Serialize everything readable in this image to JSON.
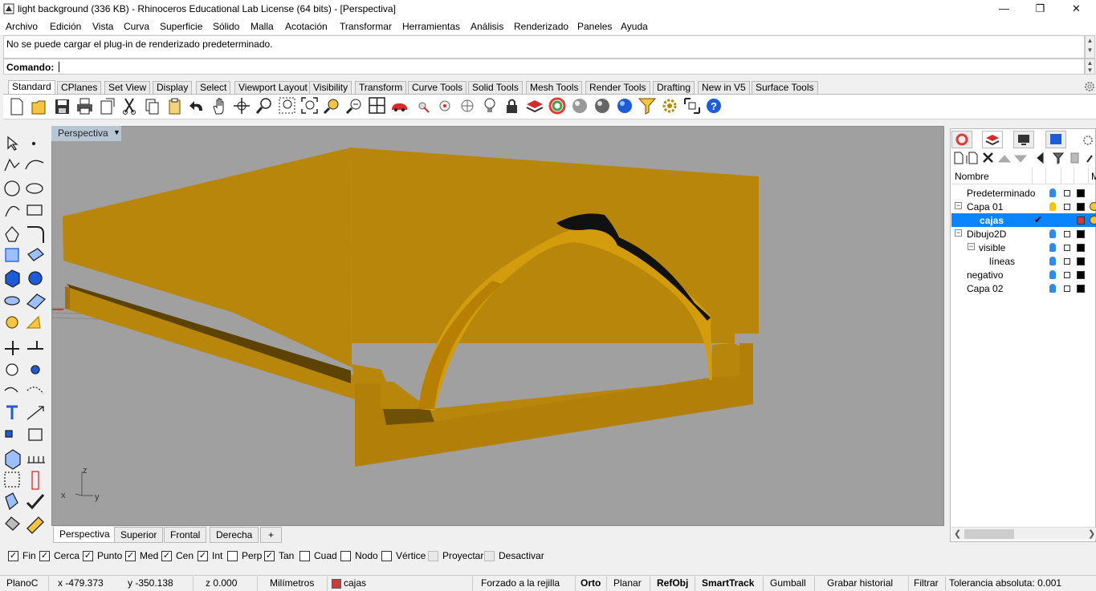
{
  "window": {
    "title": "light background (336 KB) - Rhinoceros Educational Lab License (64 bits) - [Perspectiva]",
    "minimize_icon": "minimize-icon",
    "maximize_icon": "restore-icon",
    "close_icon": "close-icon"
  },
  "menu": [
    "Archivo",
    "Edición",
    "Vista",
    "Curva",
    "Superficie",
    "Sólido",
    "Malla",
    "Acotación",
    "Transformar",
    "Herramientas",
    "Análisis",
    "Renderizado",
    "Paneles",
    "Ayuda"
  ],
  "command": {
    "history": "No se puede cargar el plug-in de renderizado predeterminado.",
    "prompt": "Comando:",
    "value": ""
  },
  "toolbar_tabs": [
    "Standard",
    "CPlanes",
    "Set View",
    "Display",
    "Select",
    "Viewport Layout",
    "Visibility",
    "Transform",
    "Curve Tools",
    "Solid Tools",
    "Mesh Tools",
    "Render Tools",
    "Drafting",
    "New in V5",
    "Surface Tools"
  ],
  "active_toolbar_tab": "Standard",
  "viewport": {
    "label": "Perspectiva",
    "axis_labels": {
      "x": "x",
      "y": "y",
      "z": "z"
    },
    "background_color": "#a0a0a0",
    "object_color": "#b8860b"
  },
  "viewport_tabs": [
    "Perspectiva",
    "Superior",
    "Frontal",
    "Derecha",
    "+"
  ],
  "active_viewport_tab": "Perspectiva",
  "osnaps": [
    {
      "label": "Fin",
      "checked": true,
      "enabled": true
    },
    {
      "label": "Cerca",
      "checked": true,
      "enabled": true
    },
    {
      "label": "Punto",
      "checked": true,
      "enabled": true
    },
    {
      "label": "Med",
      "checked": true,
      "enabled": true
    },
    {
      "label": "Cen",
      "checked": true,
      "enabled": true
    },
    {
      "label": "Int",
      "checked": true,
      "enabled": true
    },
    {
      "label": "Perp",
      "checked": false,
      "enabled": true
    },
    {
      "label": "Tan",
      "checked": true,
      "enabled": true
    },
    {
      "label": "Cuad",
      "checked": false,
      "enabled": true
    },
    {
      "label": "Nodo",
      "checked": false,
      "enabled": true
    },
    {
      "label": "Vértice",
      "checked": false,
      "enabled": true
    },
    {
      "label": "Proyectar",
      "checked": false,
      "enabled": false
    },
    {
      "label": "Desactivar",
      "checked": false,
      "enabled": false
    }
  ],
  "status": {
    "plane": "PlanoC",
    "x": "x -479.373",
    "y": "y -350.138",
    "z": "z 0.000",
    "units": "Milímetros",
    "layer": "cajas",
    "layer_color": "#c83c3c",
    "grid_snap": "Forzado a la rejilla",
    "ortho": "Orto",
    "planar": "Planar",
    "osnap": "RefObj",
    "smarttrack": "SmartTrack",
    "gumball": "Gumball",
    "history": "Grabar historial",
    "filter": "Filtrar",
    "tolerance": "Tolerancia absoluta: 0.001"
  },
  "layers_panel": {
    "column_name": "Nombre",
    "column_material": "M",
    "layers": [
      {
        "name": "Predeterminado",
        "indent": 0,
        "expander": "",
        "bulb": "#2e8be6",
        "color": "#000000",
        "selected": false,
        "current": false
      },
      {
        "name": "Capa 01",
        "indent": 0,
        "expander": "⊟",
        "bulb": "#f1c40f",
        "color": "#000000",
        "selected": false,
        "current": false
      },
      {
        "name": "cajas",
        "indent": 2,
        "expander": "",
        "bulb": "#0a84ff",
        "color": "#c83c3c",
        "selected": true,
        "current": true
      },
      {
        "name": "Dibujo2D",
        "indent": 0,
        "expander": "⊟",
        "bulb": "#2e8be6",
        "color": "#000000",
        "selected": false,
        "current": false
      },
      {
        "name": "visible",
        "indent": 1,
        "expander": "⊟",
        "bulb": "#2e8be6",
        "color": "#000000",
        "selected": false,
        "current": false
      },
      {
        "name": "líneas",
        "indent": 2,
        "expander": "",
        "bulb": "#2e8be6",
        "color": "#000000",
        "selected": false,
        "current": false
      },
      {
        "name": "negativo",
        "indent": 0,
        "expander": "",
        "bulb": "#2e8be6",
        "color": "#000000",
        "selected": false,
        "current": false
      },
      {
        "name": "Capa 02",
        "indent": 0,
        "expander": "",
        "bulb": "#2e8be6",
        "color": "#000000",
        "selected": false,
        "current": false
      }
    ]
  }
}
